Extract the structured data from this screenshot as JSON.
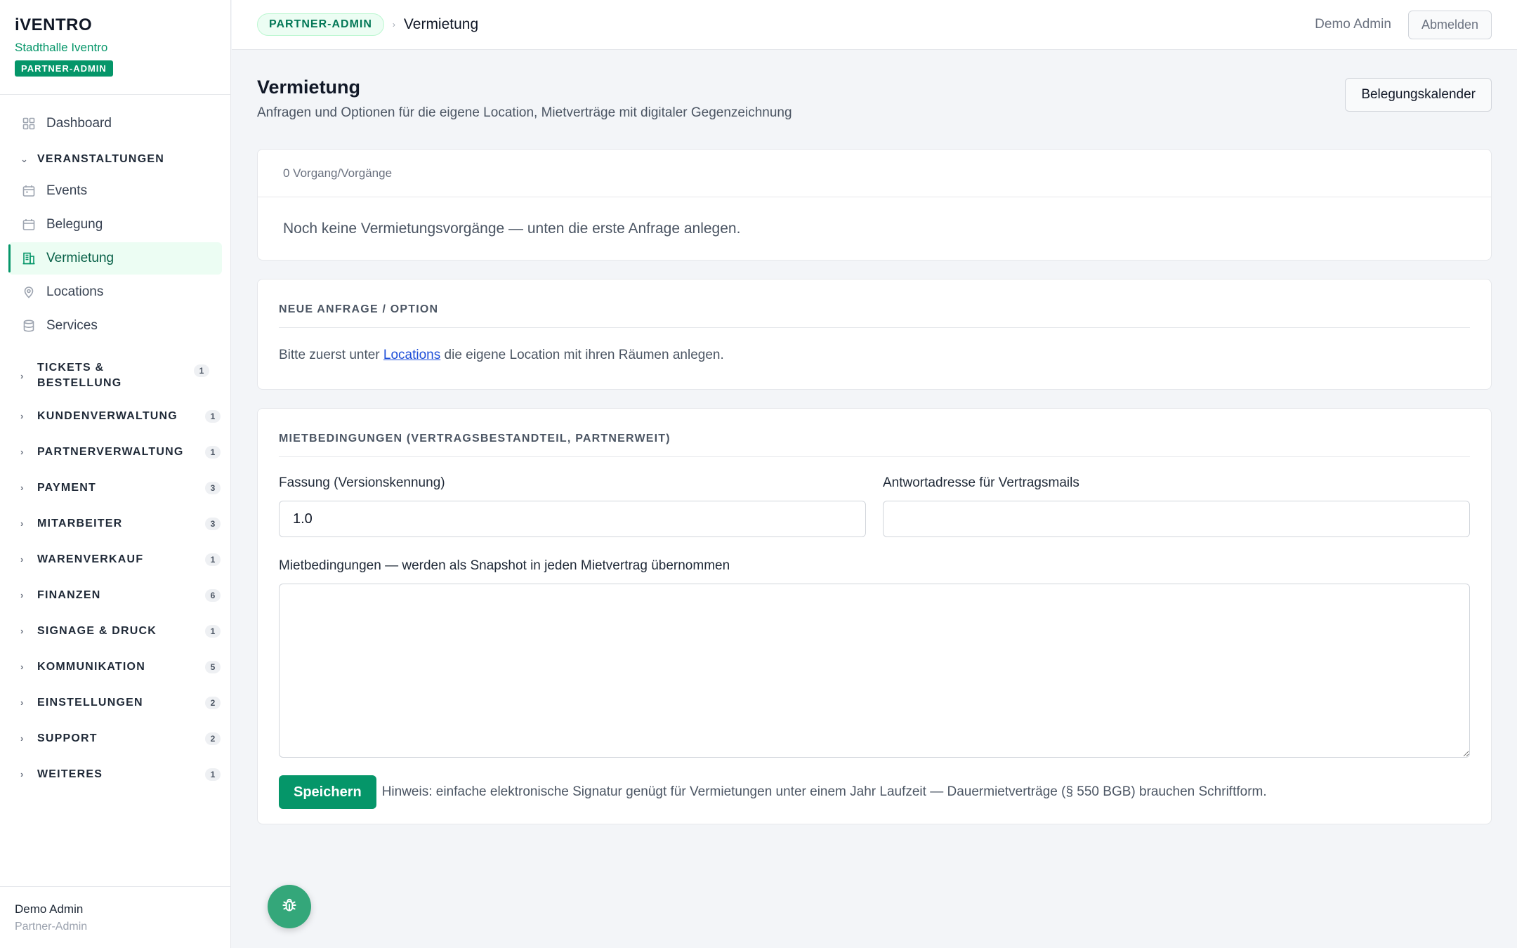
{
  "brand": {
    "logo": "iVENTRO",
    "venue": "Stadthalle Iventro",
    "role_badge": "PARTNER-ADMIN"
  },
  "sidebar": {
    "items": [
      {
        "label": "Dashboard",
        "icon": "grid-icon"
      },
      {
        "section": "VERANSTALTUNGEN"
      },
      {
        "label": "Events",
        "icon": "calendar-icon"
      },
      {
        "label": "Belegung",
        "icon": "calendar-outline-icon"
      },
      {
        "label": "Vermietung",
        "icon": "building-icon",
        "active": true
      },
      {
        "label": "Locations",
        "icon": "map-pin-icon"
      },
      {
        "label": "Services",
        "icon": "database-icon"
      }
    ],
    "sections": [
      {
        "label": "TICKETS & BESTELLUNG",
        "count": "1"
      },
      {
        "label": "KUNDENVERWALTUNG",
        "count": "1"
      },
      {
        "label": "PARTNERVERWALTUNG",
        "count": "1"
      },
      {
        "label": "PAYMENT",
        "count": "3"
      },
      {
        "label": "MITARBEITER",
        "count": "3"
      },
      {
        "label": "WARENVERKAUF",
        "count": "1"
      },
      {
        "label": "FINANZEN",
        "count": "6"
      },
      {
        "label": "SIGNAGE & DRUCK",
        "count": "1"
      },
      {
        "label": "KOMMUNIKATION",
        "count": "5"
      },
      {
        "label": "EINSTELLUNGEN",
        "count": "2"
      },
      {
        "label": "SUPPORT",
        "count": "2"
      },
      {
        "label": "WEITERES",
        "count": "1"
      }
    ],
    "footer": {
      "name": "Demo Admin",
      "role": "Partner-Admin"
    }
  },
  "topbar": {
    "badge": "PARTNER-ADMIN",
    "separator": "›",
    "title": "Vermietung",
    "user": "Demo Admin",
    "logout": "Abmelden"
  },
  "page": {
    "title": "Vermietung",
    "subtitle": "Anfragen und Optionen für die eigene Location, Mietverträge mit digitaler Gegenzeichnung",
    "calendar_button": "Belegungskalender"
  },
  "records": {
    "count_label": "0 Vorgang/Vorgänge",
    "empty_text": "Noch keine Vermietungsvorgänge — unten die erste Anfrage anlegen."
  },
  "new_request": {
    "title": "NEUE ANFRAGE / OPTION",
    "text_before": "Bitte zuerst unter ",
    "link": "Locations",
    "text_after": " die eigene Location mit ihren Räumen anlegen."
  },
  "terms": {
    "title": "MIETBEDINGUNGEN (VERTRAGSBESTANDTEIL, PARTNERWEIT)",
    "version_label": "Fassung (Versionskennung)",
    "version_value": "1.0",
    "reply_label": "Antwortadresse für Vertragsmails",
    "reply_value": "",
    "terms_label": "Mietbedingungen — werden als Snapshot in jeden Mietvertrag übernommen",
    "terms_value": "",
    "save": "Speichern",
    "hint": "Hinweis: einfache elektronische Signatur genügt für Vermietungen unter einem Jahr Laufzeit — Dauermietverträge (§ 550 BGB) brauchen Schriftform."
  },
  "colors": {
    "accent": "#059669",
    "accent_light": "#ecfdf3",
    "fab": "#34a77a"
  },
  "fab": {
    "icon": "bug-icon"
  }
}
